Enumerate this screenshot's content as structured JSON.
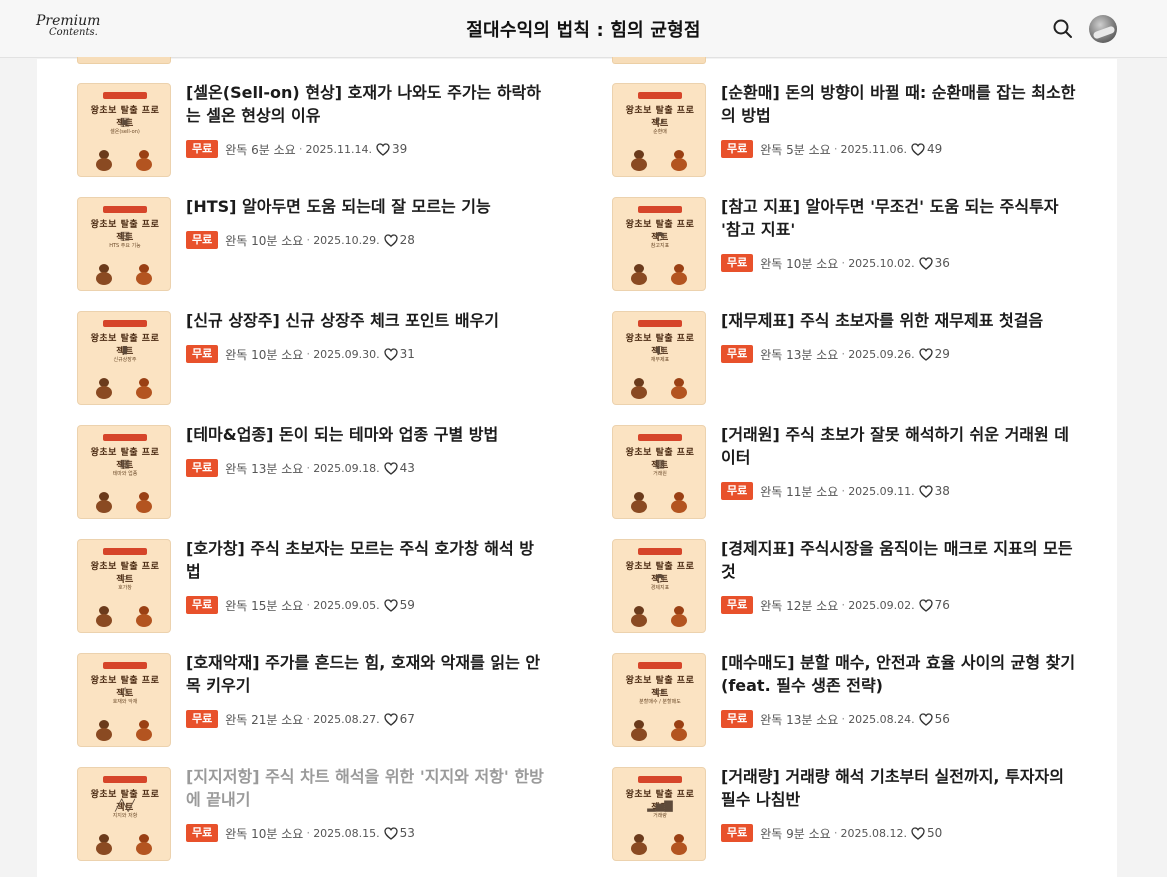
{
  "header": {
    "logo_line1": "Premium",
    "logo_line2": "Contents.",
    "title": "절대수익의 법칙 : 힘의 균형점",
    "search_icon": "search-icon",
    "avatar_icon": "user-avatar"
  },
  "colors": {
    "badge": "#e8512b",
    "thumb_bg": "#fbe3c2",
    "text": "#1b1b1b",
    "read_title": "#9a9a9a"
  },
  "thumbnail": {
    "header_text": "왕초보 탈출 프로젝트"
  },
  "posts": [
    {
      "title": "[셀온(Sell-on) 현상] 호재가 나와도 주가는 하락하는 셀온 현상의 이유",
      "badge": "무료",
      "read_time": "완독 6분 소요",
      "date": "2025.11.14.",
      "likes": "39",
      "thumb_caption": "셀온(sell-on)",
      "thumb_glyph": "▣"
    },
    {
      "title": "[순환매] 돈의 방향이 바뀔 때: 순환매를 잡는 최소한의 방법",
      "badge": "무료",
      "read_time": "완독 5분 소요",
      "date": "2025.11.06.",
      "likes": "49",
      "thumb_caption": "순환매",
      "thumb_glyph": "↻"
    },
    {
      "title": "[HTS] 알아두면 도움 되는데 잘 모르는 기능",
      "badge": "무료",
      "read_time": "완독 10분 소요",
      "date": "2025.10.29.",
      "likes": "28",
      "thumb_caption": "HTS 주요 기능",
      "thumb_glyph": "▤"
    },
    {
      "title": "[참고 지표] 알아두면 '무조건' 도움 되는 주식투자 '참고 지표'",
      "badge": "무료",
      "read_time": "완독 10분 소요",
      "date": "2025.10.02.",
      "likes": "36",
      "thumb_caption": "참고지표",
      "thumb_glyph": "◓"
    },
    {
      "title": "[신규 상장주] 신규 상장주 체크 포인트 배우기",
      "badge": "무료",
      "read_time": "완독 10분 소요",
      "date": "2025.09.30.",
      "likes": "31",
      "thumb_caption": "신규상장주",
      "thumb_glyph": "▮"
    },
    {
      "title": "[재무제표] 주식 초보자를 위한 재무제표 첫걸음",
      "badge": "무료",
      "read_time": "완독 13분 소요",
      "date": "2025.09.26.",
      "likes": "29",
      "thumb_caption": "재무제표",
      "thumb_glyph": "◐"
    },
    {
      "title": "[테마&업종] 돈이 되는 테마와 업종 구별 방법",
      "badge": "무료",
      "read_time": "완독 13분 소요",
      "date": "2025.09.18.",
      "likes": "43",
      "thumb_caption": "테마와 업종",
      "thumb_glyph": "▦"
    },
    {
      "title": "[거래원] 주식 초보가 잘못 해석하기 쉬운 거래원 데이터",
      "badge": "무료",
      "read_time": "완독 11분 소요",
      "date": "2025.09.11.",
      "likes": "38",
      "thumb_caption": "거래원",
      "thumb_glyph": "▩"
    },
    {
      "title": "[호가창] 주식 초보자는 모르는 주식 호가창 해석 방법",
      "badge": "무료",
      "read_time": "완독 15분 소요",
      "date": "2025.09.05.",
      "likes": "59",
      "thumb_caption": "호가창",
      "thumb_glyph": "⌕"
    },
    {
      "title": "[경제지표] 주식시장을 움직이는 매크로 지표의 모든 것",
      "badge": "무료",
      "read_time": "완독 12분 소요",
      "date": "2025.09.02.",
      "likes": "76",
      "thumb_caption": "경제지표",
      "thumb_glyph": "◓"
    },
    {
      "title": "[호재악재] 주가를 흔드는 힘, 호재와 악재를 읽는 안목 키우기",
      "badge": "무료",
      "read_time": "완독 21분 소요",
      "date": "2025.08.27.",
      "likes": "67",
      "thumb_caption": "호재와 악재",
      "thumb_glyph": "⚠"
    },
    {
      "title": "[매수매도] 분할 매수, 안전과 효율 사이의 균형 찾기 (feat. 필수 생존 전략)",
      "badge": "무료",
      "read_time": "완독 13분 소요",
      "date": "2025.08.24.",
      "likes": "56",
      "thumb_caption": "분할매수 / 분할매도",
      "thumb_glyph": "▭"
    },
    {
      "title": "[지지저항] 주식 차트 해석을 위한 '지지와 저항' 한방에 끝내기",
      "badge": "무료",
      "read_time": "완독 10분 소요",
      "date": "2025.08.15.",
      "likes": "53",
      "thumb_caption": "지지와 저항",
      "thumb_glyph": "╱╲╱"
    },
    {
      "title": "[거래량] 거래량 해석 기초부터 실전까지, 투자자의 필수 나침반",
      "badge": "무료",
      "read_time": "완독 9분 소요",
      "date": "2025.08.12.",
      "likes": "50",
      "thumb_caption": "거래량",
      "thumb_glyph": "▂▅▇"
    }
  ]
}
